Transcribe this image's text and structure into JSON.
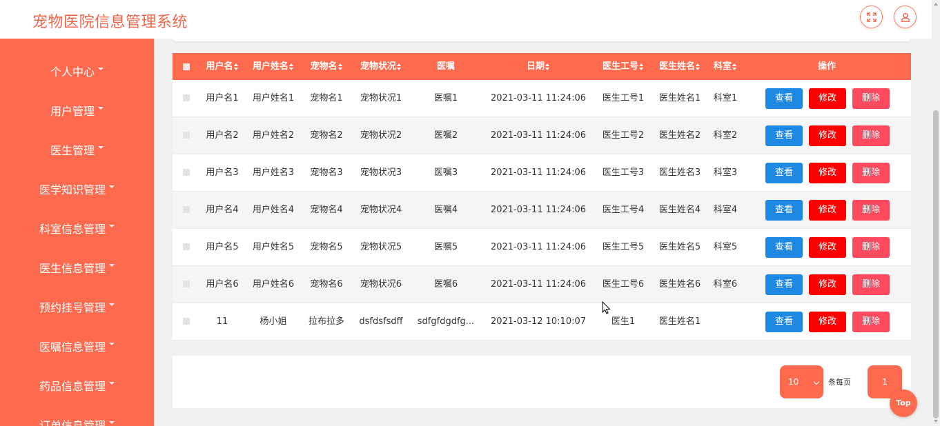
{
  "app": {
    "title": "宠物医院信息管理系统"
  },
  "header": {
    "fullscreen_icon": "fullscreen-icon",
    "user_icon": "user-icon"
  },
  "sidebar": {
    "items": [
      {
        "label": "个人中心"
      },
      {
        "label": "用户管理"
      },
      {
        "label": "医生管理"
      },
      {
        "label": "医学知识管理"
      },
      {
        "label": "科室信息管理"
      },
      {
        "label": "医生信息管理"
      },
      {
        "label": "预约挂号管理"
      },
      {
        "label": "医嘱信息管理"
      },
      {
        "label": "药品信息管理"
      },
      {
        "label": "订单信息管理"
      }
    ]
  },
  "table": {
    "columns": [
      "用户名",
      "用户姓名",
      "宠物名",
      "宠物状况",
      "医嘱",
      "日期",
      "医生工号",
      "医生姓名",
      "科室",
      "操作"
    ],
    "rows": [
      [
        "用户名1",
        "用户姓名1",
        "宠物名1",
        "宠物状况1",
        "医嘱1",
        "2021-03-11 11:24:06",
        "医生工号1",
        "医生姓名1",
        "科室1"
      ],
      [
        "用户名2",
        "用户姓名2",
        "宠物名2",
        "宠物状况2",
        "医嘱2",
        "2021-03-11 11:24:06",
        "医生工号2",
        "医生姓名2",
        "科室2"
      ],
      [
        "用户名3",
        "用户姓名3",
        "宠物名3",
        "宠物状况3",
        "医嘱3",
        "2021-03-11 11:24:06",
        "医生工号3",
        "医生姓名3",
        "科室3"
      ],
      [
        "用户名4",
        "用户姓名4",
        "宠物名4",
        "宠物状况4",
        "医嘱4",
        "2021-03-11 11:24:06",
        "医生工号4",
        "医生姓名4",
        "科室4"
      ],
      [
        "用户名5",
        "用户姓名5",
        "宠物名5",
        "宠物状况5",
        "医嘱5",
        "2021-03-11 11:24:06",
        "医生工号5",
        "医生姓名5",
        "科室5"
      ],
      [
        "用户名6",
        "用户姓名6",
        "宠物名6",
        "宠物状况6",
        "医嘱6",
        "2021-03-11 11:24:06",
        "医生工号6",
        "医生姓名6",
        "科室6"
      ],
      [
        "11",
        "杨小姐",
        "拉布拉多",
        "dsfdsfsdff",
        "sdfgfdgdfg...",
        "2021-03-12 10:10:07",
        "医生1",
        "医生姓名1",
        ""
      ]
    ],
    "actions": {
      "view": "查看",
      "edit": "修改",
      "delete": "删除"
    }
  },
  "pagination": {
    "page_size": "10",
    "per_page_label": "条每页",
    "current_page": "1"
  },
  "back_to_top": "Top",
  "colors": {
    "primary": "#fe6a4e",
    "view": "#1e88e5",
    "edit": "#ff0000",
    "delete": "#fe4a5e"
  }
}
